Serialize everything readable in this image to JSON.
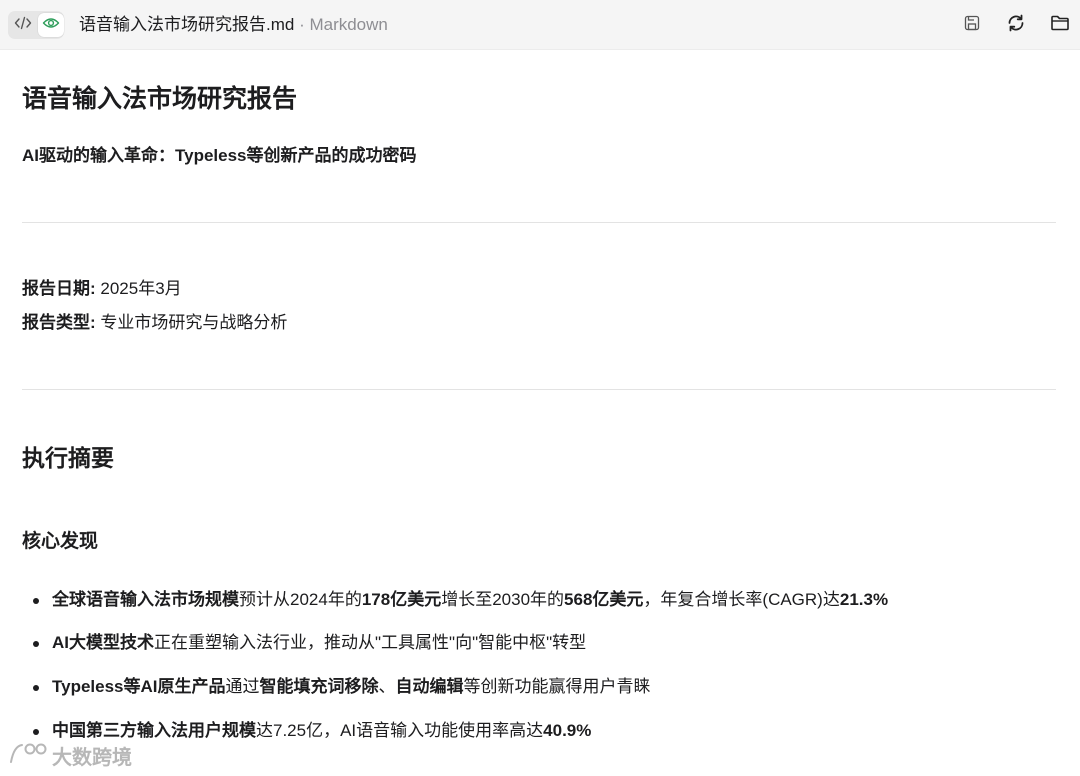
{
  "toolbar": {
    "file_name": "语音输入法市场研究报告.md",
    "file_type": " · Markdown",
    "icons": [
      "code-icon",
      "eye-icon",
      "save-icon",
      "refresh-icon",
      "folder-icon"
    ]
  },
  "document": {
    "title": "语音输入法市场研究报告",
    "subtitle": "AI驱动的输入革命：Typeless等创新产品的成功密码",
    "meta": [
      {
        "label": "报告日期:",
        "value": " 2025年3月"
      },
      {
        "label": "报告类型:",
        "value": " 专业市场研究与战略分析"
      }
    ],
    "section_title": "执行摘要",
    "subsection_title": "核心发现",
    "bullets": [
      [
        {
          "t": "全球语音输入法市场规模",
          "b": true
        },
        {
          "t": "预计从2024年的",
          "b": false
        },
        {
          "t": "178亿美元",
          "b": true
        },
        {
          "t": "增长至2030年的",
          "b": false
        },
        {
          "t": "568亿美元",
          "b": true
        },
        {
          "t": "，年复合增长率(CAGR)达",
          "b": false
        },
        {
          "t": "21.3%",
          "b": true
        }
      ],
      [
        {
          "t": "AI大模型技术",
          "b": true
        },
        {
          "t": "正在重塑输入法行业，推动从\"工具属性\"向\"智能中枢\"转型",
          "b": false
        }
      ],
      [
        {
          "t": "Typeless等AI原生产品",
          "b": true
        },
        {
          "t": "通过",
          "b": false
        },
        {
          "t": "智能填充词移除",
          "b": true
        },
        {
          "t": "、",
          "b": false
        },
        {
          "t": "自动编辑",
          "b": true
        },
        {
          "t": "等创新功能赢得用户青睐",
          "b": false
        }
      ],
      [
        {
          "t": "中国第三方输入法用户规模",
          "b": true
        },
        {
          "t": "达7.25亿，AI语音输入功能使用率高达",
          "b": false
        },
        {
          "t": "40.9%",
          "b": true
        }
      ]
    ]
  },
  "watermark": {
    "text": "大数跨境"
  },
  "colors": {
    "accent_green": "#2e9e5b",
    "toolbar_bg": "#f5f5f5",
    "text": "#1d1d1f",
    "muted": "#8e8e93"
  }
}
